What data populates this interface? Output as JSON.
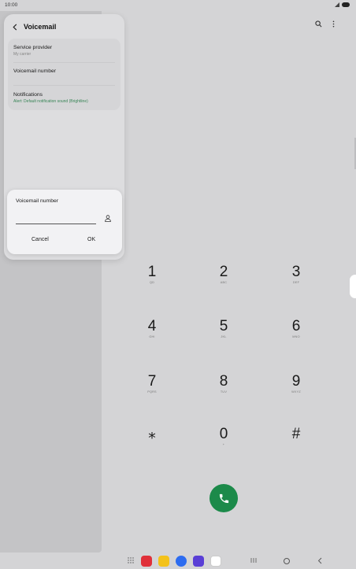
{
  "status": {
    "time": "10:00"
  },
  "voicemail": {
    "title": "Voicemail",
    "settings": [
      {
        "title": "Service provider",
        "subtitle": "My carrier"
      },
      {
        "title": "Voicemail number",
        "subtitle": ""
      },
      {
        "title": "Notifications",
        "subtitle": "Alert: Default notification sound (Brightline)"
      }
    ]
  },
  "dialog": {
    "title": "Voicemail number",
    "input_value": "",
    "cancel_label": "Cancel",
    "ok_label": "OK"
  },
  "dialpad": {
    "keys": [
      {
        "num": "1",
        "letters": "QD"
      },
      {
        "num": "2",
        "letters": "ABC"
      },
      {
        "num": "3",
        "letters": "DEF"
      },
      {
        "num": "4",
        "letters": "GHI"
      },
      {
        "num": "5",
        "letters": "JKL"
      },
      {
        "num": "6",
        "letters": "MNO"
      },
      {
        "num": "7",
        "letters": "PQRS"
      },
      {
        "num": "8",
        "letters": "TUV"
      },
      {
        "num": "9",
        "letters": "WXYZ"
      },
      {
        "num": "⁎",
        "letters": ""
      },
      {
        "num": "0",
        "letters": "+"
      },
      {
        "num": "#",
        "letters": ""
      }
    ]
  },
  "icons": {
    "search": "search-icon",
    "more": "more-options-icon",
    "contact": "contact-icon",
    "call": "phone-icon",
    "back": "back-arrow-icon"
  },
  "colors": {
    "call_button": "#1c8a4a",
    "notification_subtitle": "#3b8a5a",
    "background": "#d4d4d6"
  },
  "dock": {
    "apps": [
      {
        "name": "dock-app-red",
        "color": "#e0303a"
      },
      {
        "name": "dock-app-yellow",
        "color": "#f3c21b"
      },
      {
        "name": "dock-app-blue",
        "color": "#2d6cf0"
      },
      {
        "name": "dock-app-purple",
        "color": "#5a3fd6"
      },
      {
        "name": "dock-app-camera",
        "color": "#ffffff"
      }
    ]
  }
}
